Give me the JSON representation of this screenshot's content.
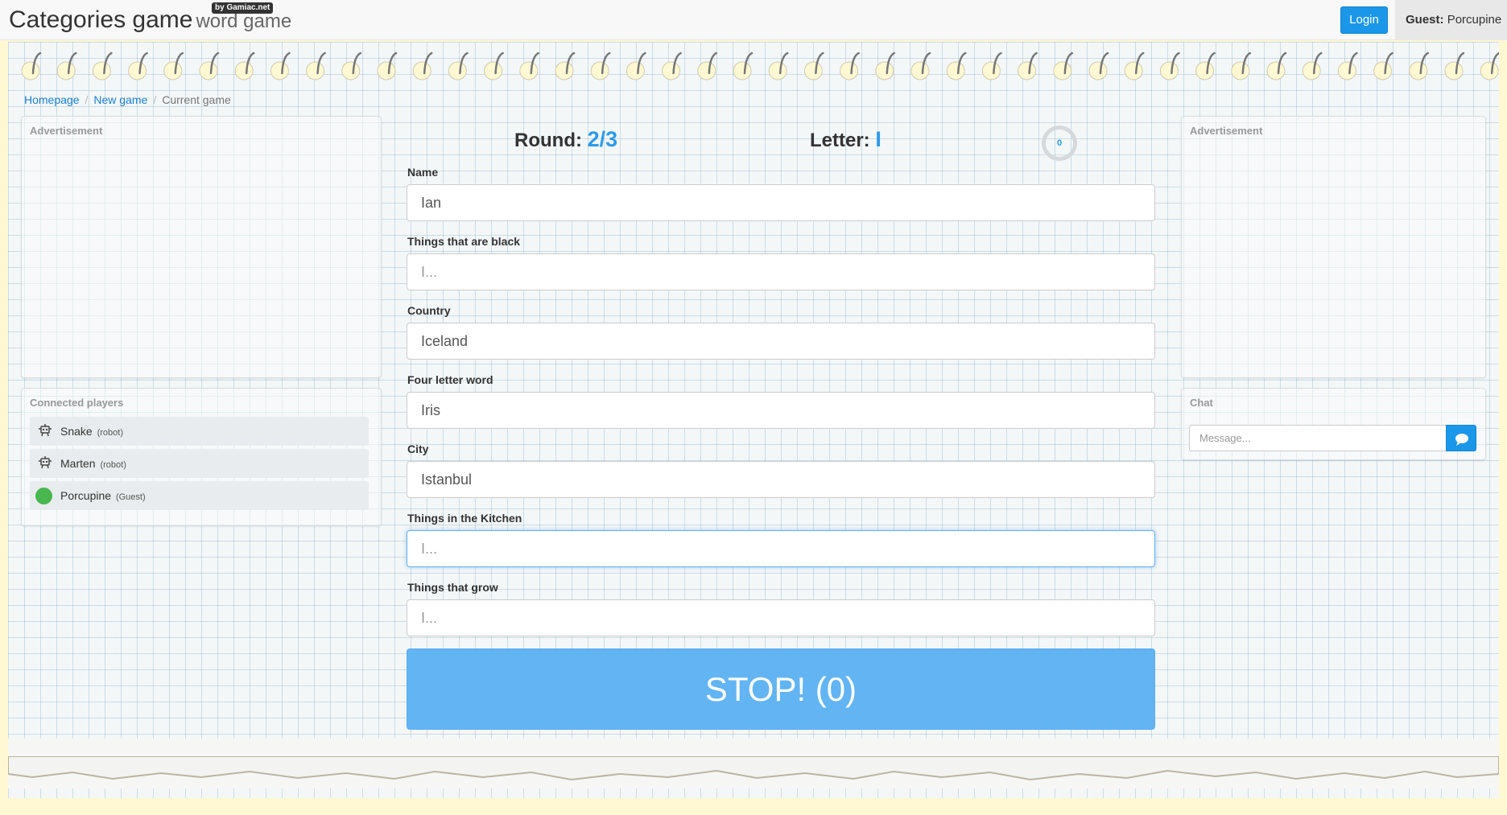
{
  "header": {
    "brand_title": "Categories game",
    "brand_subtitle": "word game",
    "brand_badge": "by Gamiac.net",
    "login_label": "Login",
    "guest_prefix": "Guest:",
    "guest_name": "Porcupine"
  },
  "breadcrumb": {
    "home": "Homepage",
    "new_game": "New game",
    "current": "Current game",
    "separator": "/"
  },
  "left_ad": {
    "title": "Advertisement"
  },
  "right_ad": {
    "title": "Advertisement"
  },
  "players": {
    "title": "Connected players",
    "items": [
      {
        "name": "Snake",
        "type": "(robot)",
        "icon": "robot-icon"
      },
      {
        "name": "Marten",
        "type": "(robot)",
        "icon": "robot-icon"
      },
      {
        "name": "Porcupine",
        "type": "(Guest)",
        "icon": "online-dot"
      }
    ]
  },
  "game": {
    "round_label": "Round:",
    "round_value": "2/3",
    "letter_label": "Letter:",
    "letter_value": "I",
    "timer_value": "0",
    "fields": [
      {
        "label": "Name",
        "value": "Ian",
        "placeholder": "I..."
      },
      {
        "label": "Things that are black",
        "value": "",
        "placeholder": "I..."
      },
      {
        "label": "Country",
        "value": "Iceland",
        "placeholder": "I..."
      },
      {
        "label": "Four letter word",
        "value": "Iris",
        "placeholder": "I..."
      },
      {
        "label": "City",
        "value": "Istanbul",
        "placeholder": "I..."
      },
      {
        "label": "Things in the Kitchen",
        "value": "",
        "placeholder": "I..."
      },
      {
        "label": "Things that grow",
        "value": "",
        "placeholder": "I..."
      }
    ],
    "stop_label": "STOP! (0)"
  },
  "chat": {
    "title": "Chat",
    "placeholder": "Message...",
    "send_icon": "comment-icon"
  },
  "colors": {
    "accent": "#2e9ae8",
    "button": "#1a97e8",
    "stop_button": "#62b4f3",
    "online": "#49b64f",
    "background": "#fff8d2"
  }
}
